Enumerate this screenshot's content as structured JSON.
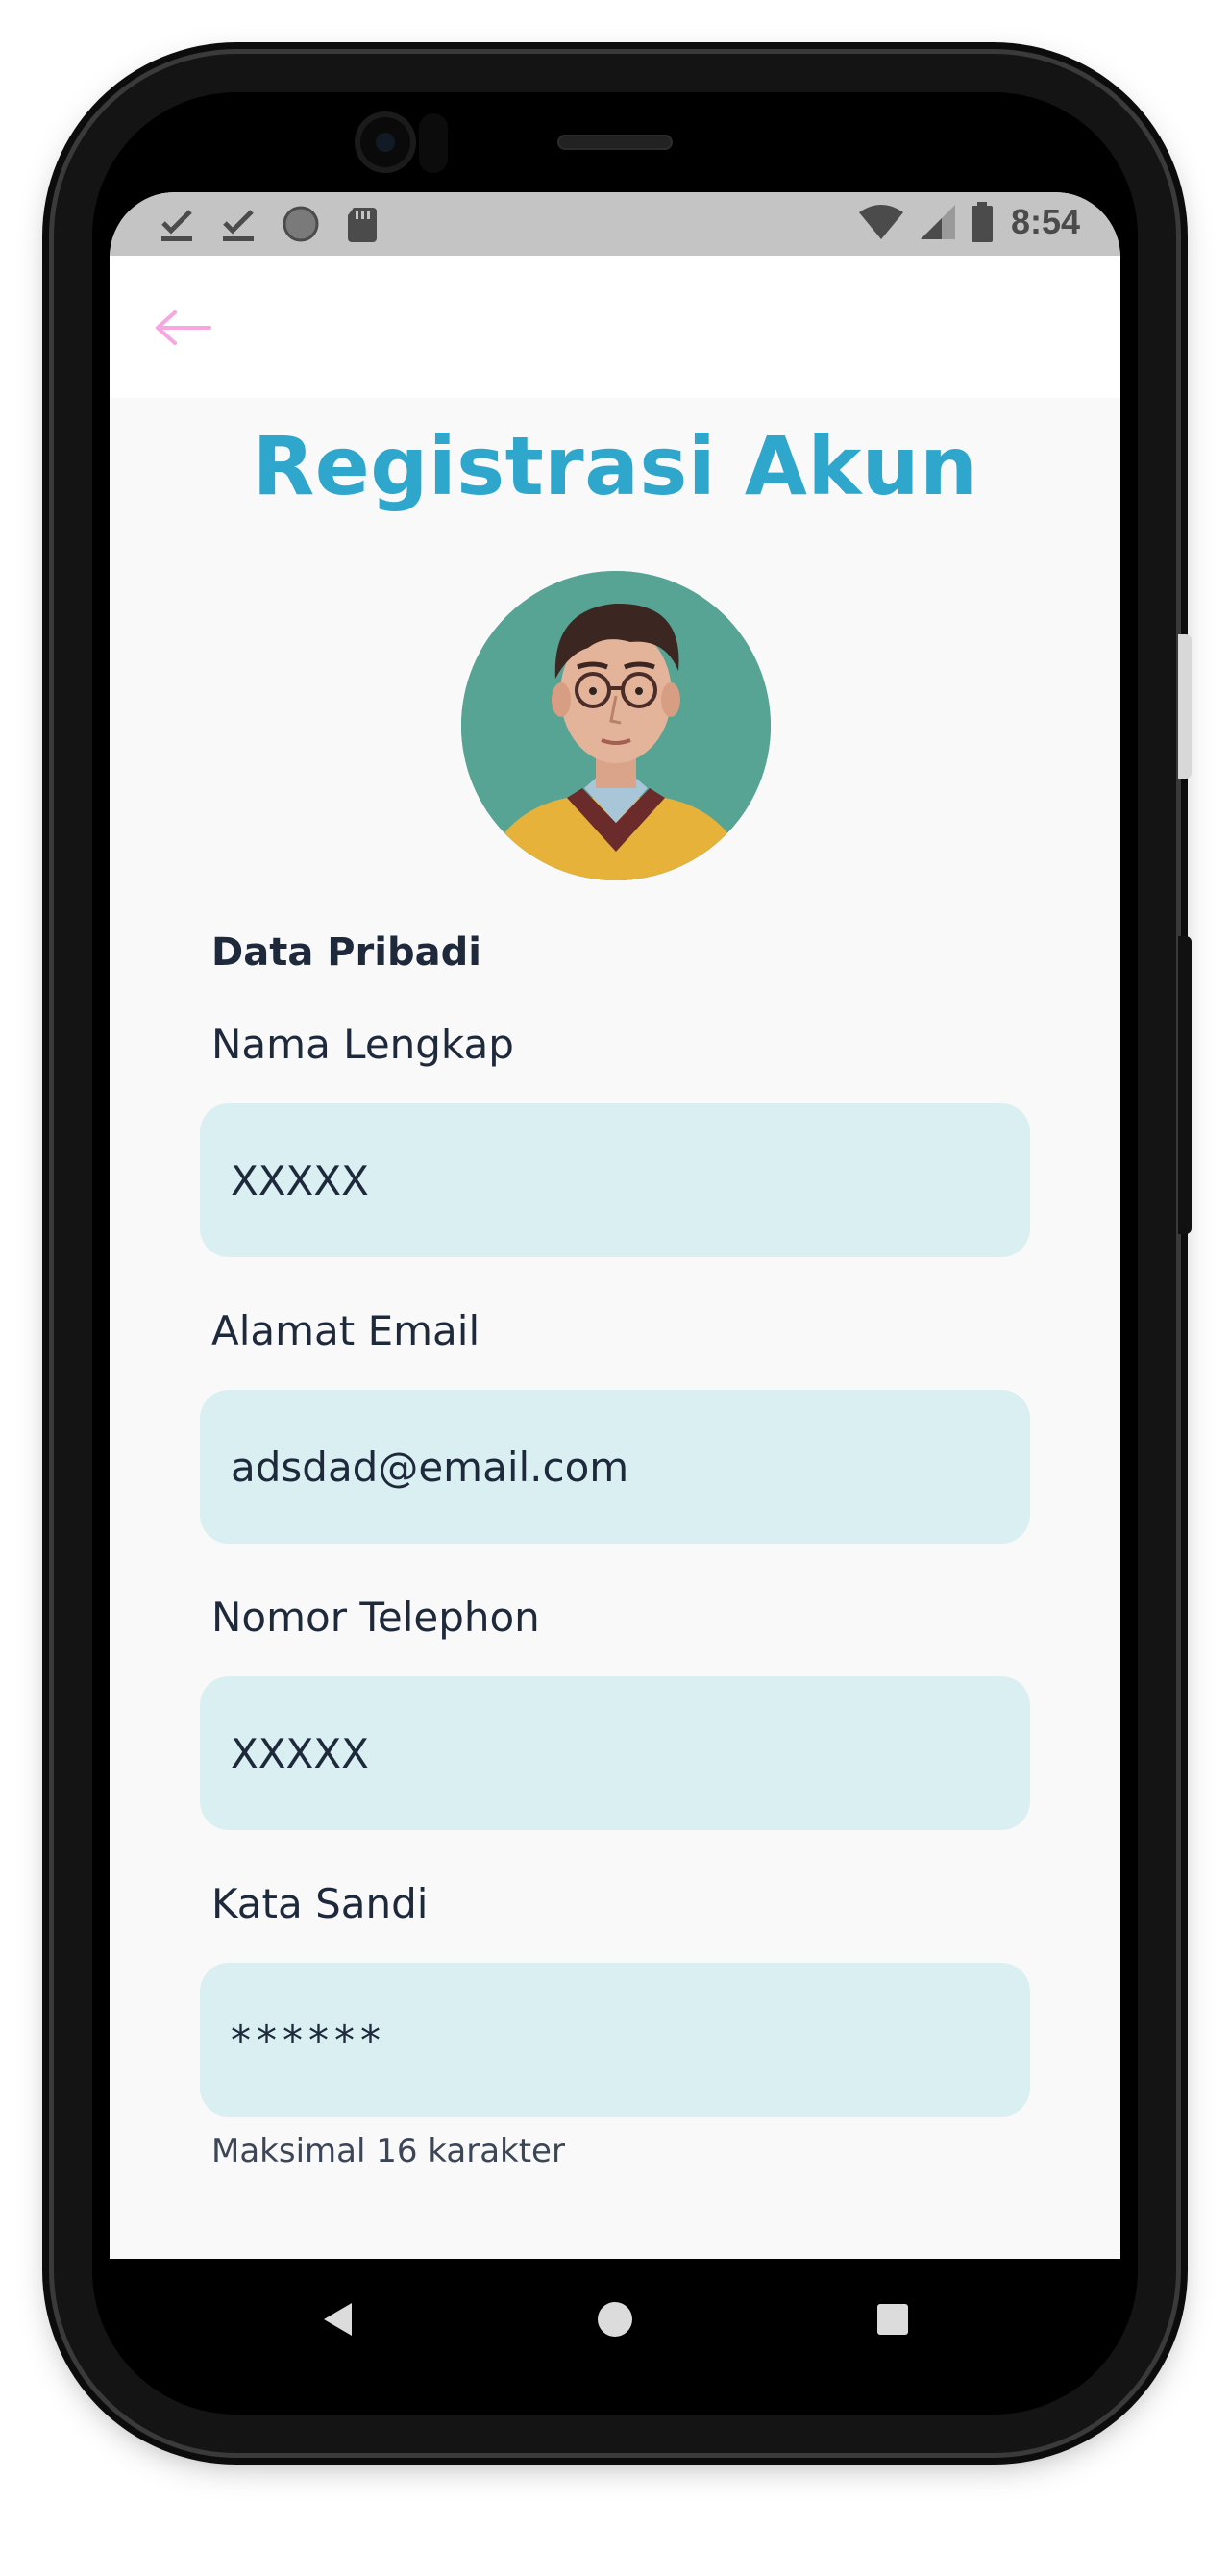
{
  "status_bar": {
    "time": "8:54",
    "left_icons": [
      "check-download-icon",
      "check-download-icon",
      "circle-icon",
      "sd-card-icon"
    ],
    "right_icons": [
      "wifi-icon",
      "cell-signal-icon",
      "battery-icon"
    ]
  },
  "app_bar": {
    "back_icon": "arrow-left-icon",
    "back_color": "#f7a6df"
  },
  "page": {
    "title": "Registrasi Akun",
    "title_color": "#2fa6cc",
    "avatar": "profile-photo"
  },
  "form": {
    "section_title": "Data Pribadi",
    "fields": [
      {
        "label": "Nama Lengkap",
        "value": "XXXXX"
      },
      {
        "label": "Alamat Email",
        "value": "adsdad@email.com"
      },
      {
        "label": "Nomor Telephon",
        "value": "XXXXX"
      },
      {
        "label": "Kata Sandi",
        "value": "******"
      }
    ],
    "password_hint": "Maksimal 16 karakter",
    "field_bg": "#daeff1"
  },
  "nav_bar": {
    "buttons": [
      "back-triangle-icon",
      "home-circle-icon",
      "recents-square-icon"
    ]
  }
}
